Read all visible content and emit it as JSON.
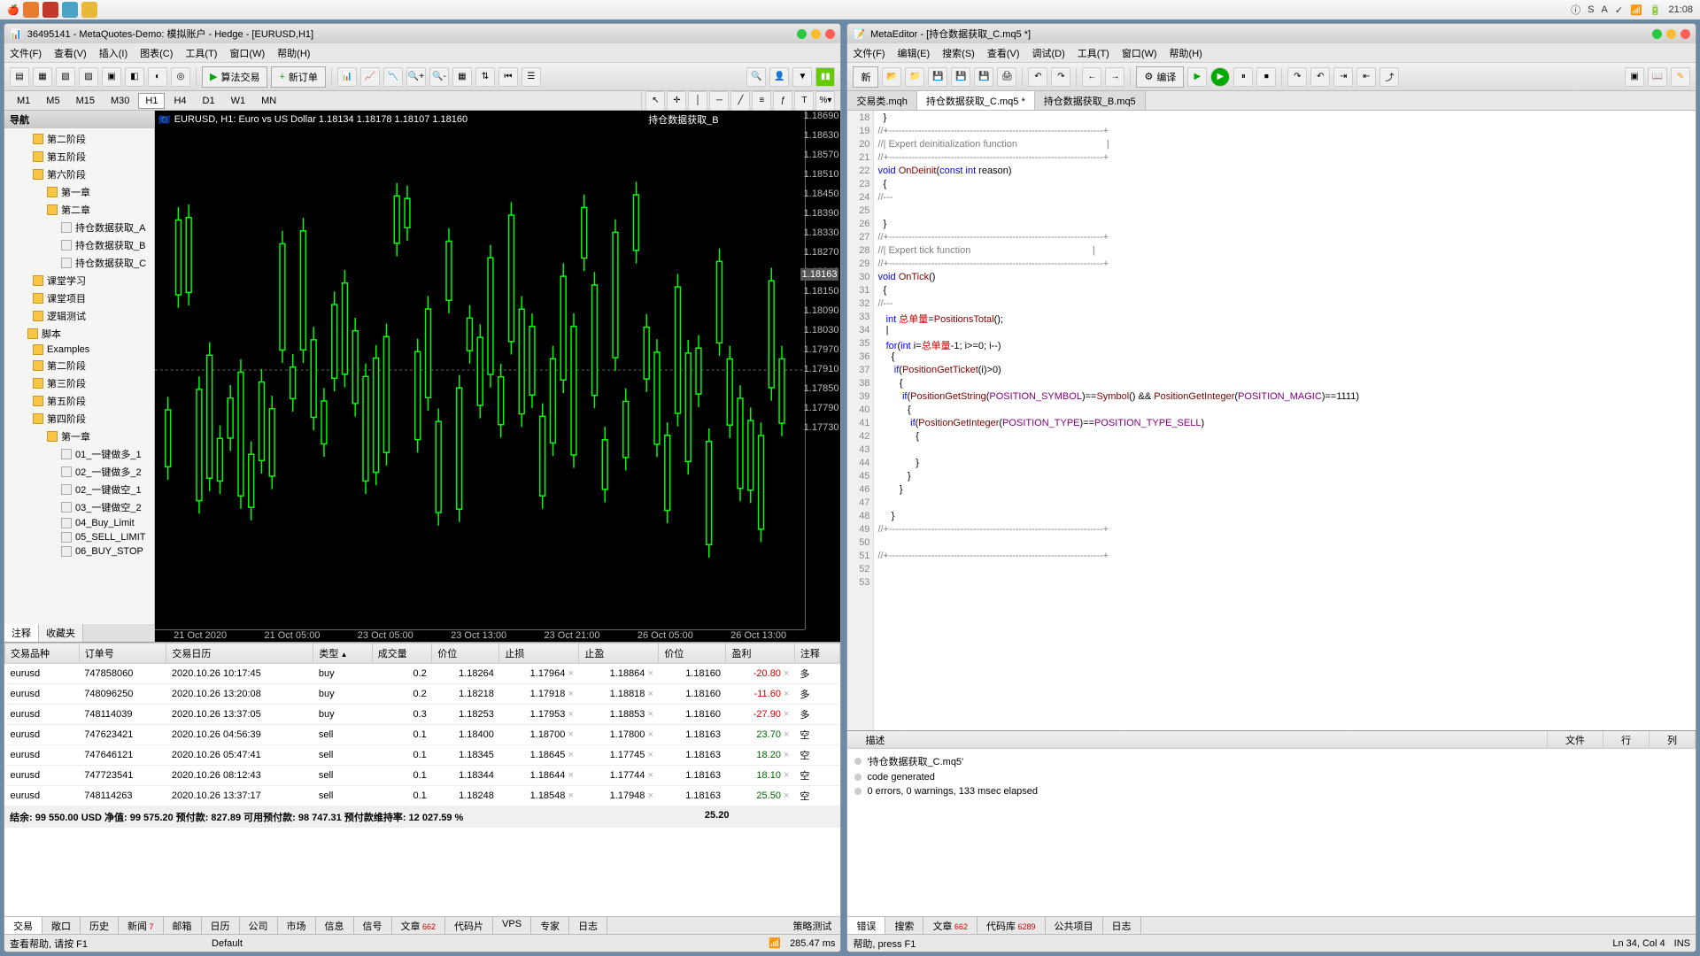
{
  "mac": {
    "time": "21:08",
    "icons": [
      "a",
      "b",
      "c",
      "d",
      "e"
    ]
  },
  "mt5": {
    "title": "36495141 - MetaQuotes-Demo: 模拟账户 - Hedge - [EURUSD,H1]",
    "menus": [
      "文件(F)",
      "查看(V)",
      "插入(I)",
      "图表(C)",
      "工具(T)",
      "窗口(W)",
      "帮助(H)"
    ],
    "algo_label": "算法交易",
    "new_order_label": "新订单",
    "timeframes": [
      "M1",
      "M5",
      "M15",
      "M30",
      "H1",
      "H4",
      "D1",
      "W1",
      "MN"
    ],
    "tf_active": "H1",
    "nav_title": "导航",
    "nav_tabs": [
      "注释",
      "收藏夹"
    ],
    "tree": [
      {
        "l": "l1",
        "t": "folder",
        "label": "第二阶段"
      },
      {
        "l": "l1",
        "t": "folder",
        "label": "第五阶段"
      },
      {
        "l": "l1",
        "t": "folder",
        "label": "第六阶段"
      },
      {
        "l": "l2",
        "t": "folder",
        "label": "第一章"
      },
      {
        "l": "l2",
        "t": "folder",
        "label": "第二章"
      },
      {
        "l": "l3",
        "t": "file",
        "label": "持仓数据获取_A"
      },
      {
        "l": "l3",
        "t": "file",
        "label": "持仓数据获取_B"
      },
      {
        "l": "l3",
        "t": "file",
        "label": "持仓数据获取_C"
      },
      {
        "l": "l1",
        "t": "folder",
        "label": "课堂学习"
      },
      {
        "l": "l1",
        "t": "folder",
        "label": "课堂项目"
      },
      {
        "l": "l1",
        "t": "folder",
        "label": "逻辑测试"
      },
      {
        "l": "l0",
        "t": "folder",
        "label": "脚本"
      },
      {
        "l": "l1",
        "t": "folder",
        "label": "Examples"
      },
      {
        "l": "l1",
        "t": "folder",
        "label": "第二阶段"
      },
      {
        "l": "l1",
        "t": "folder",
        "label": "第三阶段"
      },
      {
        "l": "l1",
        "t": "folder",
        "label": "第五阶段"
      },
      {
        "l": "l1",
        "t": "folder",
        "label": "第四阶段"
      },
      {
        "l": "l2",
        "t": "folder",
        "label": "第一章"
      },
      {
        "l": "l3",
        "t": "file",
        "label": "01_一键做多_1"
      },
      {
        "l": "l3",
        "t": "file",
        "label": "02_一键做多_2"
      },
      {
        "l": "l3",
        "t": "file",
        "label": "02_一键做空_1"
      },
      {
        "l": "l3",
        "t": "file",
        "label": "03_一键做空_2"
      },
      {
        "l": "l3",
        "t": "file",
        "label": "04_Buy_Limit"
      },
      {
        "l": "l3",
        "t": "file",
        "label": "05_SELL_LIMIT"
      },
      {
        "l": "l3",
        "t": "file",
        "label": "06_BUY_STOP"
      }
    ],
    "chart_label": "EURUSD, H1: Euro vs US Dollar  1.18134 1.18178 1.18107 1.18160",
    "chart_badge": "持仓数据获取_B",
    "chart_data": {
      "type": "candlestick",
      "ylim": [
        1.1773,
        1.1869
      ],
      "price_ticks": [
        "1.18690",
        "1.18630",
        "1.18570",
        "1.18510",
        "1.18450",
        "1.18390",
        "1.18330",
        "1.18270",
        "1.18210",
        "1.18150",
        "1.18090",
        "1.18030",
        "1.17970",
        "1.17910",
        "1.17850",
        "1.17790",
        "1.17730"
      ],
      "current_price": "1.18163",
      "time_ticks": [
        "21 Oct 2020",
        "21 Oct 05:00",
        "23 Oct 05:00",
        "23 Oct 13:00",
        "23 Oct 21:00",
        "26 Oct 05:00",
        "26 Oct 13:00"
      ]
    },
    "columns": [
      "交易品种",
      "订单号",
      "交易日历",
      "类型",
      "成交量",
      "价位",
      "止损",
      "止盈",
      "价位",
      "盈利",
      "注释"
    ],
    "trades": [
      {
        "sym": "eurusd",
        "ord": "747858060",
        "dt": "2020.10.26 10:17:45",
        "ty": "buy",
        "vol": "0.2",
        "p1": "1.18264",
        "sl": "1.17964",
        "tp": "1.18864",
        "p2": "1.18160",
        "pnl": "-20.80",
        "cls": "neg",
        "note": "多"
      },
      {
        "sym": "eurusd",
        "ord": "748096250",
        "dt": "2020.10.26 13:20:08",
        "ty": "buy",
        "vol": "0.2",
        "p1": "1.18218",
        "sl": "1.17918",
        "tp": "1.18818",
        "p2": "1.18160",
        "pnl": "-11.60",
        "cls": "neg",
        "note": "多"
      },
      {
        "sym": "eurusd",
        "ord": "748114039",
        "dt": "2020.10.26 13:37:05",
        "ty": "buy",
        "vol": "0.3",
        "p1": "1.18253",
        "sl": "1.17953",
        "tp": "1.18853",
        "p2": "1.18160",
        "pnl": "-27.90",
        "cls": "neg",
        "note": "多"
      },
      {
        "sym": "eurusd",
        "ord": "747623421",
        "dt": "2020.10.26 04:56:39",
        "ty": "sell",
        "vol": "0.1",
        "p1": "1.18400",
        "sl": "1.18700",
        "tp": "1.17800",
        "p2": "1.18163",
        "pnl": "23.70",
        "cls": "pos",
        "note": "空"
      },
      {
        "sym": "eurusd",
        "ord": "747646121",
        "dt": "2020.10.26 05:47:41",
        "ty": "sell",
        "vol": "0.1",
        "p1": "1.18345",
        "sl": "1.18645",
        "tp": "1.17745",
        "p2": "1.18163",
        "pnl": "18.20",
        "cls": "pos",
        "note": "空"
      },
      {
        "sym": "eurusd",
        "ord": "747723541",
        "dt": "2020.10.26 08:12:43",
        "ty": "sell",
        "vol": "0.1",
        "p1": "1.18344",
        "sl": "1.18644",
        "tp": "1.17744",
        "p2": "1.18163",
        "pnl": "18.10",
        "cls": "pos",
        "note": "空"
      },
      {
        "sym": "eurusd",
        "ord": "748114263",
        "dt": "2020.10.26 13:37:17",
        "ty": "sell",
        "vol": "0.1",
        "p1": "1.18248",
        "sl": "1.18548",
        "tp": "1.17948",
        "p2": "1.18163",
        "pnl": "25.50",
        "cls": "pos",
        "note": "空"
      }
    ],
    "balance": "结余: 99 550.00 USD   净值: 99 575.20   预付款: 827.89   可用预付款: 98 747.31   预付款维持率: 12 027.59 %",
    "balance_pnl": "25.20",
    "term_tabs": [
      "交易",
      "敞口",
      "历史",
      "新闻",
      "邮箱",
      "日历",
      "公司",
      "市场",
      "信息",
      "信号",
      "文章",
      "代码片",
      "VPS",
      "专家",
      "日志"
    ],
    "tab_badges": {
      "新闻": "7",
      "文章": "662"
    },
    "strategy_test": "策略测试",
    "status": "查看帮助, 请按 F1",
    "status_default": "Default",
    "ping": "285.47 ms"
  },
  "me": {
    "title": "MetaEditor - [持仓数据获取_C.mq5 *]",
    "menus": [
      "文件(F)",
      "编辑(E)",
      "搜索(S)",
      "查看(V)",
      "调试(D)",
      "工具(T)",
      "窗口(W)",
      "帮助(H)"
    ],
    "new_label": "新",
    "compile_label": "编译",
    "tabs": [
      "交易类.mqh",
      "持仓数据获取_C.mq5 *",
      "持仓数据获取_B.mq5"
    ],
    "tab_active": 1,
    "line_start": 18,
    "code_lines": [
      {
        "raw": "  }"
      },
      {
        "cls": "cm",
        "raw": "//+------------------------------------------------------------------+"
      },
      {
        "cls": "cm",
        "raw": "//| Expert deinitialization function                                 |"
      },
      {
        "cls": "cm",
        "raw": "//+------------------------------------------------------------------+"
      },
      {
        "html": "<span class='kw'>void</span> <span class='fn'>OnDeinit</span>(<span class='kw'>const int</span> reason)"
      },
      {
        "raw": "  {"
      },
      {
        "cls": "cm",
        "raw": "//---"
      },
      {
        "raw": ""
      },
      {
        "raw": "  }"
      },
      {
        "cls": "cm",
        "raw": "//+------------------------------------------------------------------+"
      },
      {
        "cls": "cm",
        "raw": "//| Expert tick function                                             |"
      },
      {
        "cls": "cm",
        "raw": "//+------------------------------------------------------------------+"
      },
      {
        "html": "<span class='kw'>void</span> <span class='fn'>OnTick</span>()"
      },
      {
        "raw": "  {"
      },
      {
        "cls": "cm",
        "raw": "//---"
      },
      {
        "html": "   <span class='kw'>int</span> <span class='red'>总单量</span>=<span class='fn'>PositionsTotal</span>();"
      },
      {
        "raw": "   |"
      },
      {
        "html": "   <span class='kw'>for</span>(<span class='kw'>int</span> i=<span class='red'>总单量</span>-1; i&gt;=0; i--)"
      },
      {
        "raw": "     {"
      },
      {
        "html": "      <span class='kw'>if</span>(<span class='fn'>PositionGetTicket</span>(i)&gt;0)"
      },
      {
        "raw": "        {"
      },
      {
        "html": "         <span class='kw'>if</span>(<span class='fn'>PositionGetString</span>(<span class='const'>POSITION_SYMBOL</span>)==<span class='fn'>Symbol</span>() &amp;&amp; <span class='fn'>PositionGetInteger</span>(<span class='const'>POSITION_MAGIC</span>)==1111)"
      },
      {
        "raw": "           {"
      },
      {
        "html": "            <span class='kw'>if</span>(<span class='fn'>PositionGetInteger</span>(<span class='const'>POSITION_TYPE</span>)==<span class='const'>POSITION_TYPE_SELL</span>)"
      },
      {
        "raw": "              {"
      },
      {
        "raw": ""
      },
      {
        "raw": "              }"
      },
      {
        "raw": "           }"
      },
      {
        "raw": "        }"
      },
      {
        "raw": ""
      },
      {
        "raw": "     }"
      },
      {
        "cls": "cm",
        "raw": "//+------------------------------------------------------------------+"
      },
      {
        "raw": ""
      },
      {
        "cls": "cm",
        "raw": "//+------------------------------------------------------------------+"
      },
      {
        "raw": ""
      },
      {
        "raw": ""
      }
    ],
    "out_headers": [
      "描述",
      "文件",
      "行",
      "列"
    ],
    "out_lines": [
      "'持仓数据获取_C.mq5'",
      "code generated",
      "0 errors, 0 warnings, 133 msec elapsed"
    ],
    "out_tabs": [
      "错误",
      "搜索",
      "文章",
      "代码库",
      "公共项目",
      "日志"
    ],
    "out_badges": {
      "文章": "662",
      "代码库": "6289"
    },
    "status": "帮助, press F1",
    "cursor": "Ln 34, Col 4",
    "ins": "INS"
  }
}
